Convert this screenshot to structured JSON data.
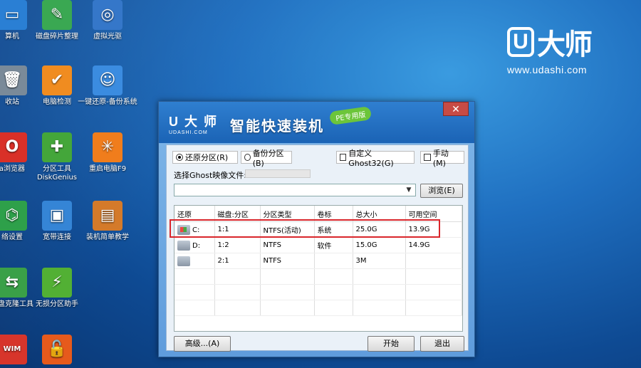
{
  "desktop": {
    "icons": [
      {
        "label": "算机",
        "color": "#2a7fd4"
      },
      {
        "label": "磁盘碎片整理",
        "color": "#3aa852"
      },
      {
        "label": "虚拟光驱",
        "color": "#3577c9"
      },
      {
        "label": "收站",
        "color": "#7a8a99"
      },
      {
        "label": "电脑检测",
        "color": "#f08c20"
      },
      {
        "label": "一键还原-备份系统",
        "color": "#3b8ce0"
      },
      {
        "label": "a浏览器",
        "color": "#d93028"
      },
      {
        "label": "分区工具 DiskGenius",
        "color": "#44a63a"
      },
      {
        "label": "重启电脑F9",
        "color": "#f07d1c"
      },
      {
        "label": "络设置",
        "color": "#2ea04a"
      },
      {
        "label": "宽带连接",
        "color": "#3585d6"
      },
      {
        "label": "装机简单教学",
        "color": "#d47a2a"
      },
      {
        "label": "动盘克隆工具",
        "color": "#3aa048"
      },
      {
        "label": "无损分区助手",
        "color": "#52b034"
      },
      {
        "label": "WIM",
        "color": "#d7352b"
      },
      {
        "label": "",
        "color": "#e65a1c"
      }
    ]
  },
  "brand": {
    "logo_letter": "U",
    "logo_text": "大师",
    "url": "www.udashi.com"
  },
  "dialog": {
    "close_label": "✕",
    "brand_top": "U 大 师",
    "brand_bottom": "UDASHI.COM",
    "title": "智能快速装机",
    "badge": "PE专用版",
    "options": {
      "restore": "还原分区(R)",
      "backup": "备份分区(B)",
      "custom_ghost": "自定义Ghost32(G)",
      "manual": "手动(M)"
    },
    "ghost_label": "选择Ghost映像文件:",
    "file_value": "",
    "browse_label": "浏览(E)",
    "table": {
      "headers": [
        "还原",
        "磁盘:分区",
        "分区类型",
        "卷标",
        "总大小",
        "可用空间"
      ],
      "rows": [
        {
          "drive": "C:",
          "disk": "1:1",
          "type": "NTFS(活动)",
          "label": "系统",
          "total": "25.0G",
          "free": "13.9G"
        },
        {
          "drive": "D:",
          "disk": "1:2",
          "type": "NTFS",
          "label": "软件",
          "total": "15.0G",
          "free": "14.9G"
        },
        {
          "drive": "",
          "disk": "2:1",
          "type": "NTFS",
          "label": "",
          "total": "3M",
          "free": ""
        }
      ]
    },
    "buttons": {
      "advanced": "高级...(A)",
      "start": "开始",
      "exit": "退出"
    }
  }
}
